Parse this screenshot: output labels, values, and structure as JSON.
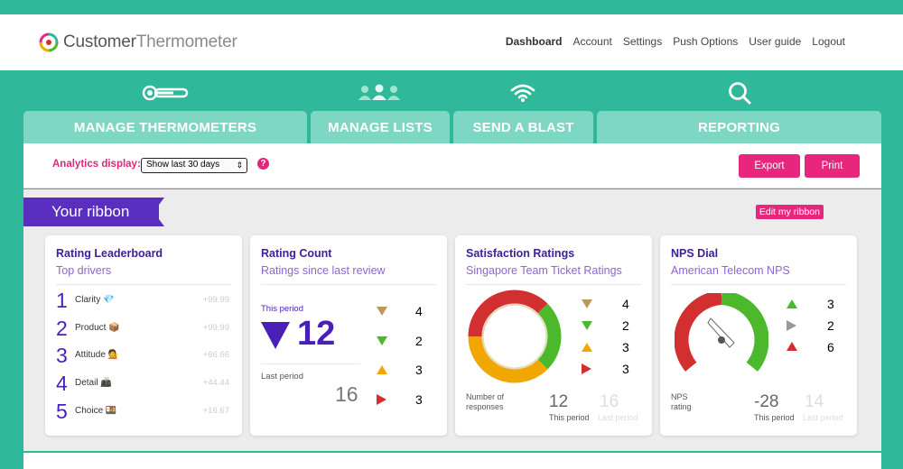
{
  "brand": {
    "name_part1": "Customer",
    "name_part2": "Thermometer"
  },
  "topnav": [
    "Dashboard",
    "Account",
    "Settings",
    "Push Options",
    "User guide",
    "Logout"
  ],
  "icons": [
    "thermometer-icon",
    "users-icon",
    "wifi-icon",
    "search-icon"
  ],
  "tabs": [
    "MANAGE THERMOMETERS",
    "MANAGE LISTS",
    "SEND A BLAST",
    "REPORTING"
  ],
  "controls": {
    "analytics_label": "Analytics display:",
    "select_value": "Show last 30 days",
    "help": "?",
    "export": "Export",
    "print": "Print"
  },
  "ribbon": {
    "label": "Your ribbon",
    "edit": "Edit my ribbon"
  },
  "leaderboard": {
    "title": "Rating Leaderboard",
    "subtitle": "Top drivers",
    "rows": [
      {
        "rank": "1",
        "label": "Clarity 💎",
        "value": "+99.99"
      },
      {
        "rank": "2",
        "label": "Product 📦",
        "value": "+99.99"
      },
      {
        "rank": "3",
        "label": "Attitude 💁",
        "value": "+66.66"
      },
      {
        "rank": "4",
        "label": "Detail 📠",
        "value": "+44.44"
      },
      {
        "rank": "5",
        "label": "Choice 🍱",
        "value": "+16.67"
      }
    ]
  },
  "rating_count": {
    "title": "Rating Count",
    "subtitle": "Ratings since last review",
    "this_period_label": "This period",
    "this_period_value": "12",
    "last_period_label": "Last period",
    "last_period_value": "16",
    "breakdown": [
      {
        "icon": "down-triangle-tan",
        "value": "4",
        "color": "#b89a5a"
      },
      {
        "icon": "down-triangle-green",
        "value": "2",
        "color": "#4cb82c"
      },
      {
        "icon": "up-triangle-amber",
        "value": "3",
        "color": "#f0a800"
      },
      {
        "icon": "right-triangle-red",
        "value": "3",
        "color": "#d23030"
      }
    ]
  },
  "satisfaction": {
    "title": "Satisfaction Ratings",
    "subtitle": "Singapore Team Ticket Ratings",
    "responses_label_1": "Number of",
    "responses_label_2": "responses",
    "this_value": "12",
    "last_value": "16",
    "this_label": "This period",
    "last_label": "Last period",
    "breakdown": [
      {
        "icon": "down-triangle-tan",
        "value": "4",
        "color": "#b89a5a"
      },
      {
        "icon": "down-triangle-green",
        "value": "2",
        "color": "#4cb82c"
      },
      {
        "icon": "up-triangle-amber",
        "value": "3",
        "color": "#f0a800"
      },
      {
        "icon": "right-triangle-red",
        "value": "3",
        "color": "#d23030"
      }
    ]
  },
  "nps": {
    "title": "NPS Dial",
    "subtitle": "American Telecom NPS",
    "rating_label_1": "NPS",
    "rating_label_2": "rating",
    "this_value": "-28",
    "last_value": "14",
    "this_label": "This period",
    "last_label": "Last period",
    "breakdown": [
      {
        "icon": "up-triangle-green",
        "value": "3",
        "color": "#4cb82c"
      },
      {
        "icon": "right-triangle-grey",
        "value": "2",
        "color": "#999999"
      },
      {
        "icon": "up-triangle-red",
        "value": "6",
        "color": "#d23030"
      }
    ]
  },
  "colors": {
    "teal": "#2fb89a",
    "tab": "#7ed7c3",
    "pink": "#e8267d",
    "purple": "#5a2fc0",
    "tan": "#b89a5a",
    "green": "#4cb82c",
    "amber": "#f0a800",
    "red": "#d23030"
  }
}
